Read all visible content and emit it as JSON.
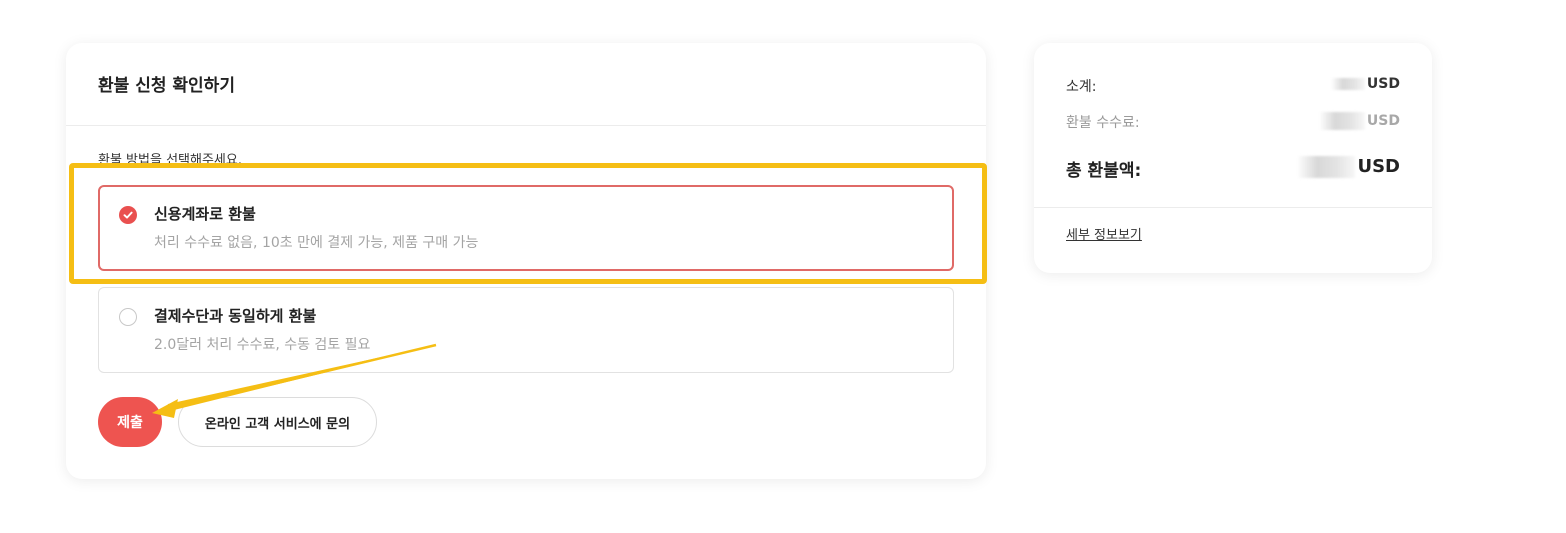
{
  "refund": {
    "title": "환불 신청 확인하기",
    "instruction": "환불 방법을 선택해주세요.",
    "options": [
      {
        "title": "신용계좌로 환불",
        "description": "처리 수수료 없음, 10초 만에 결제 가능, 제품 구매 가능",
        "selected": true
      },
      {
        "title": "결제수단과 동일하게 환불",
        "description": "2.0달러 처리 수수료, 수동 검토 필요",
        "selected": false
      }
    ],
    "submit_label": "제출",
    "support_label": "온라인 고객 서비스에 문의"
  },
  "summary": {
    "subtotal_label": "소계:",
    "subtotal_currency": "USD",
    "fee_label": "환불 수수료:",
    "fee_currency": "USD",
    "total_label": "총 환불액:",
    "total_currency": "USD",
    "detail_link": "세부 정보보기"
  },
  "colors": {
    "accent": "#ee5450",
    "selected_border": "#e06a67",
    "annotation": "#f5be14"
  },
  "icons": {
    "selected_radio": "check-circle-icon",
    "unselected_radio": "radio-empty-icon"
  }
}
